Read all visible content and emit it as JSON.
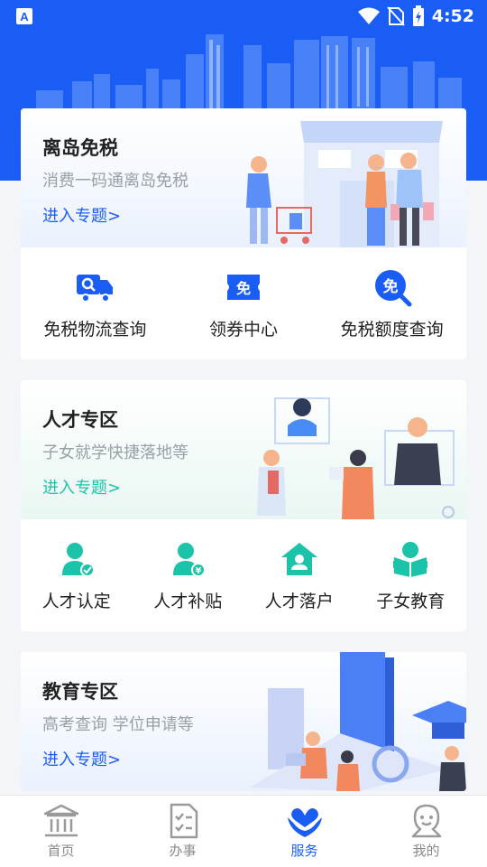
{
  "status_bar": {
    "time": "4:52"
  },
  "cards": [
    {
      "title": "离岛免税",
      "subtitle": "消费一码通离岛免税",
      "link": "进入专题>",
      "features": [
        {
          "label": "免税物流查询",
          "icon": "truck-search-icon"
        },
        {
          "label": "领券中心",
          "icon": "coupon-icon"
        },
        {
          "label": "免税额度查询",
          "icon": "quota-search-icon"
        }
      ]
    },
    {
      "title": "人才专区",
      "subtitle": "子女就学快捷落地等",
      "link": "进入专题>",
      "features": [
        {
          "label": "人才认定",
          "icon": "person-check-icon"
        },
        {
          "label": "人才补贴",
          "icon": "person-yen-icon"
        },
        {
          "label": "人才落户",
          "icon": "house-person-icon"
        },
        {
          "label": "子女教育",
          "icon": "child-book-icon"
        }
      ]
    },
    {
      "title": "教育专区",
      "subtitle": "高考查询 学位申请等",
      "link": "进入专题>"
    }
  ],
  "tabbar": [
    {
      "label": "首页",
      "icon": "bank-icon"
    },
    {
      "label": "办事",
      "icon": "checklist-icon"
    },
    {
      "label": "服务",
      "icon": "heart-hands-icon",
      "active": true
    },
    {
      "label": "我的",
      "icon": "user-icon"
    }
  ],
  "colors": {
    "primary": "#1a5df5",
    "teal": "#1bc3a8"
  }
}
